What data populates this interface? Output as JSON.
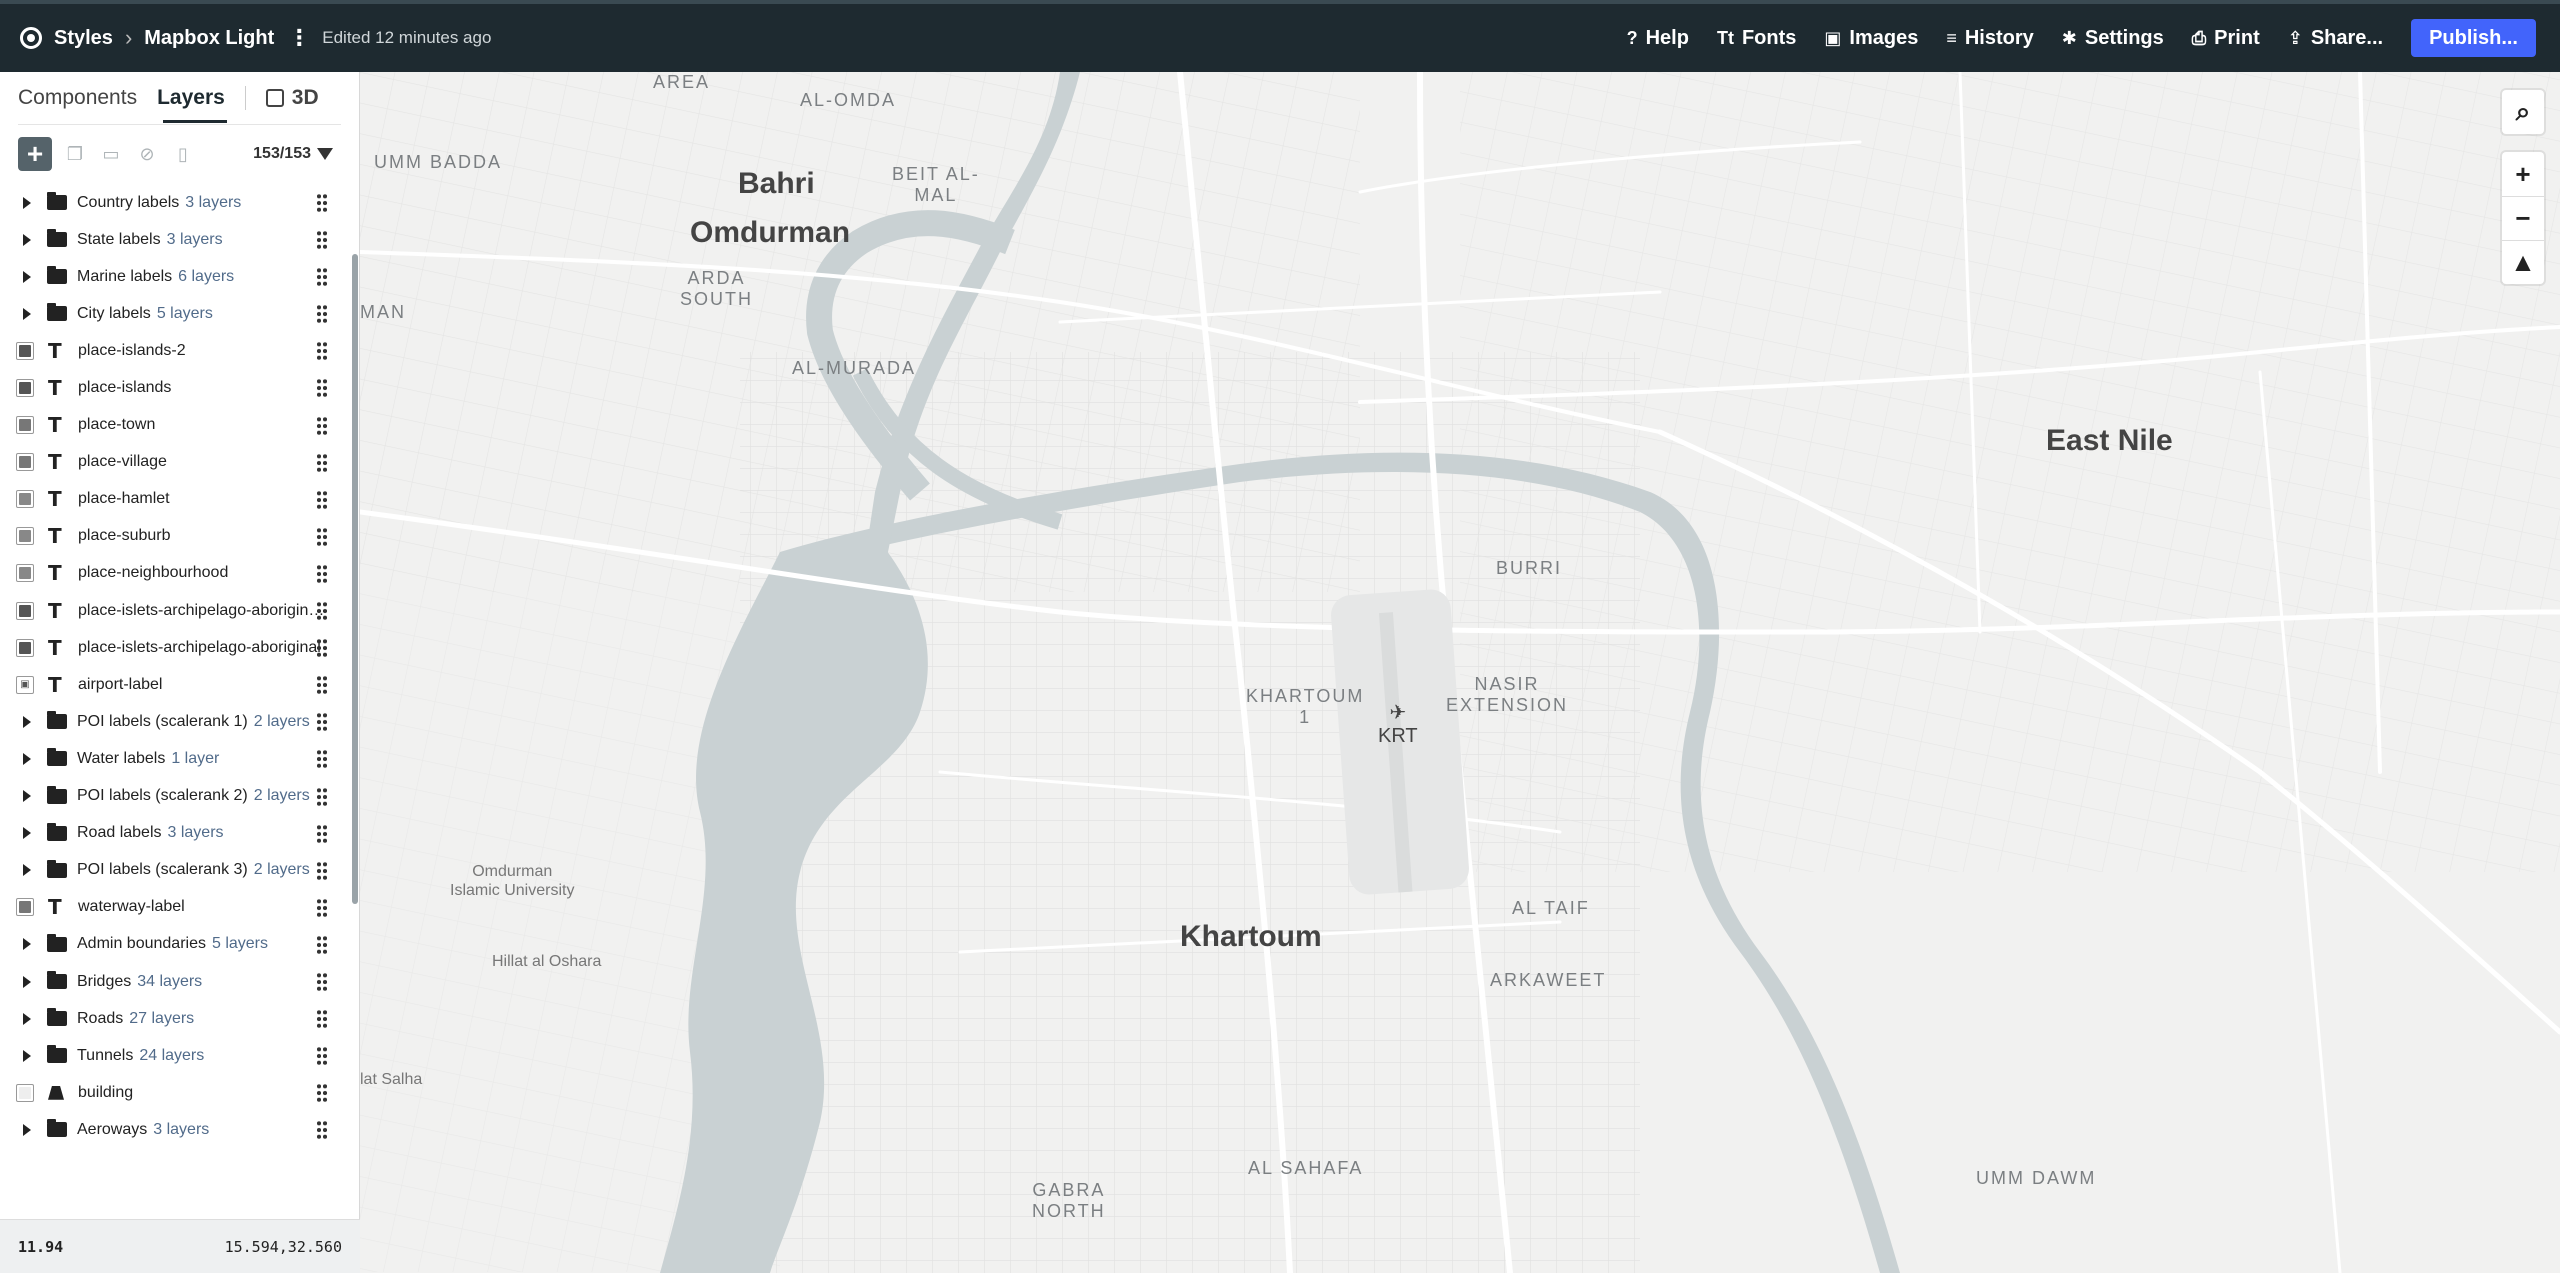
{
  "header": {
    "crumb_root": "Styles",
    "style_name": "Mapbox Light",
    "edited": "Edited 12 minutes ago",
    "actions": [
      {
        "label": "Help",
        "icon": "help-icon",
        "glyph": "?"
      },
      {
        "label": "Fonts",
        "icon": "fonts-icon",
        "glyph": "Tt"
      },
      {
        "label": "Images",
        "icon": "images-icon",
        "glyph": "▣"
      },
      {
        "label": "History",
        "icon": "history-icon",
        "glyph": "≡"
      },
      {
        "label": "Settings",
        "icon": "settings-icon",
        "glyph": "✱"
      },
      {
        "label": "Print",
        "icon": "print-icon",
        "glyph": "⎙"
      },
      {
        "label": "Share...",
        "icon": "share-icon",
        "glyph": "⇪"
      }
    ],
    "publish": "Publish..."
  },
  "sidebar": {
    "tabs": {
      "components": "Components",
      "layers": "Layers",
      "three_d": "3D"
    },
    "count": "153/153",
    "layers": [
      {
        "type": "group",
        "name": "Country labels",
        "sub": "3 layers"
      },
      {
        "type": "group",
        "name": "State labels",
        "sub": "3 layers"
      },
      {
        "type": "group",
        "name": "Marine labels",
        "sub": "6 layers"
      },
      {
        "type": "group",
        "name": "City labels",
        "sub": "5 layers"
      },
      {
        "type": "symbol",
        "name": "place-islands-2",
        "swatch": "#555555"
      },
      {
        "type": "symbol",
        "name": "place-islands",
        "swatch": "#555555"
      },
      {
        "type": "symbol",
        "name": "place-town",
        "swatch": "#777777"
      },
      {
        "type": "symbol",
        "name": "place-village",
        "swatch": "#777777"
      },
      {
        "type": "symbol",
        "name": "place-hamlet",
        "swatch": "#888888"
      },
      {
        "type": "symbol",
        "name": "place-suburb",
        "swatch": "#888888"
      },
      {
        "type": "symbol",
        "name": "place-neighbourhood",
        "swatch": "#888888"
      },
      {
        "type": "symbol",
        "name": "place-islets-archipelago-aboriginal...",
        "swatch": "#555555"
      },
      {
        "type": "symbol",
        "name": "place-islets-archipelago-aboriginal",
        "swatch": "#555555"
      },
      {
        "type": "symbol",
        "name": "airport-label",
        "swatch": "image"
      },
      {
        "type": "group",
        "name": "POI labels (scalerank 1)",
        "sub": "2 layers"
      },
      {
        "type": "group",
        "name": "Water labels",
        "sub": "1 layer"
      },
      {
        "type": "group",
        "name": "POI labels (scalerank 2)",
        "sub": "2 layers"
      },
      {
        "type": "group",
        "name": "Road labels",
        "sub": "3 layers"
      },
      {
        "type": "group",
        "name": "POI labels (scalerank 3)",
        "sub": "2 layers"
      },
      {
        "type": "symbol",
        "name": "waterway-label",
        "swatch": "#777777"
      },
      {
        "type": "group",
        "name": "Admin boundaries",
        "sub": "5 layers"
      },
      {
        "type": "group",
        "name": "Bridges",
        "sub": "34 layers"
      },
      {
        "type": "group",
        "name": "Roads",
        "sub": "27 layers"
      },
      {
        "type": "group",
        "name": "Tunnels",
        "sub": "24 layers"
      },
      {
        "type": "fill",
        "name": "building",
        "swatch": "#eeeeee"
      },
      {
        "type": "group",
        "name": "Aeroways",
        "sub": "3 layers"
      }
    ],
    "footer": {
      "zoom": "11.94",
      "coords": "15.594,32.560"
    }
  },
  "map": {
    "cities": {
      "bahri": "Bahri",
      "omdurman": "Omdurman",
      "east_nile": "East Nile",
      "khartoum": "Khartoum"
    },
    "districts": {
      "area": "AREA",
      "al_omda": "AL-OMDA",
      "umm_badda": "UMM BADDA",
      "beit_al_mal": "BEIT AL-\nMAL",
      "arda_south": "ARDA\nSOUTH",
      "man": "MAN",
      "al_murada": "AL-MURADA",
      "burri": "BURRI",
      "khartoum_1": "KHARTOUM\n1",
      "nasir": "NASIR\nEXTENSION",
      "al_taif": "AL TAIF",
      "arkaweet": "ARKAWEET",
      "al_sahafa": "AL SAHAFA",
      "gabra": "GABRA\nNORTH",
      "umm_dawm": "UMM DAWM"
    },
    "pois": {
      "oiu": "Omdurman\nIslamic University",
      "hillat": "Hillat al Oshara",
      "lat_salha": "lat Salha"
    },
    "airport": "KRT"
  }
}
